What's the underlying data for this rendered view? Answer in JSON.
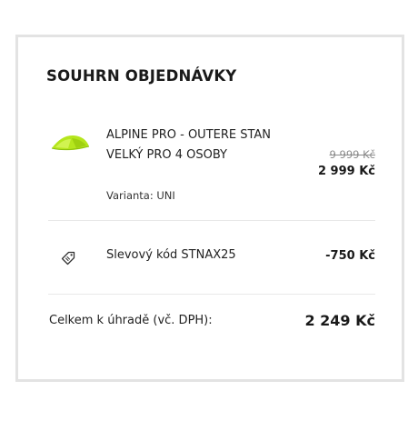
{
  "summary": {
    "title": "SOUHRN OBJEDNÁVKY",
    "product": {
      "name": "ALPINE PRO - OUTERE STAN VELKÝ PRO 4 OSOBY",
      "variant": "Varianta: UNI",
      "old_price": "9 999 Kč",
      "price": "2 999 Kč",
      "thumbnail_icon": "tent-icon",
      "thumbnail_color": "#b5e61d"
    },
    "discount": {
      "icon": "tag-icon",
      "label": "Slevový kód STNAX25",
      "amount": "-750 Kč"
    },
    "total": {
      "label": "Celkem k úhradě (vč. DPH):",
      "amount": "2 249 Kč"
    }
  }
}
